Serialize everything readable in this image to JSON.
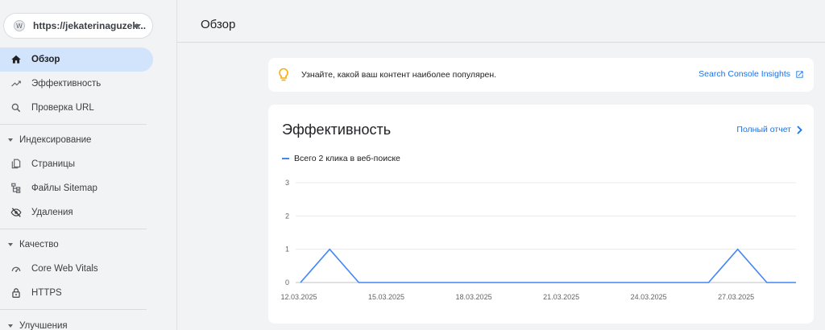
{
  "property": {
    "url": "https://jekaterinaguzek...",
    "icon": "wordpress-icon"
  },
  "sidebar": {
    "items": [
      {
        "label": "Обзор",
        "icon": "home-icon",
        "active": true
      },
      {
        "label": "Эффективность",
        "icon": "trending-up-icon"
      },
      {
        "label": "Проверка URL",
        "icon": "search-icon"
      }
    ],
    "sections": [
      {
        "label": "Индексирование",
        "items": [
          {
            "label": "Страницы",
            "icon": "pages-icon"
          },
          {
            "label": "Файлы Sitemap",
            "icon": "sitemap-icon"
          },
          {
            "label": "Удаления",
            "icon": "eye-off-icon"
          }
        ]
      },
      {
        "label": "Качество",
        "items": [
          {
            "label": "Core Web Vitals",
            "icon": "gauge-icon"
          },
          {
            "label": "HTTPS",
            "icon": "lock-icon"
          }
        ]
      },
      {
        "label": "Улучшения",
        "items": []
      }
    ]
  },
  "header": {
    "title": "Обзор"
  },
  "banner": {
    "text": "Узнайте, какой ваш контент наиболее популярен.",
    "link": "Search Console Insights",
    "icon": "lightbulb-icon",
    "link_icon": "open-in-new-icon"
  },
  "performance": {
    "title": "Эффективность",
    "full_report": "Полный отчет",
    "legend": "Всего 2 клика в веб-поиске"
  },
  "colors": {
    "accent": "#1a73e8",
    "series": "#4285f4",
    "active_nav": "#d2e3fc"
  },
  "chart_data": {
    "type": "line",
    "title": "",
    "xlabel": "",
    "ylabel": "",
    "ylim": [
      0,
      3
    ],
    "yticks": [
      0,
      1,
      2,
      3
    ],
    "x_ticks": [
      "12.03.2025",
      "15.03.2025",
      "18.03.2025",
      "21.03.2025",
      "24.03.2025",
      "27.03.2025"
    ],
    "x": [
      "12.03.2025",
      "13.03.2025",
      "14.03.2025",
      "15.03.2025",
      "16.03.2025",
      "17.03.2025",
      "18.03.2025",
      "19.03.2025",
      "20.03.2025",
      "21.03.2025",
      "22.03.2025",
      "23.03.2025",
      "24.03.2025",
      "25.03.2025",
      "26.03.2025",
      "27.03.2025",
      "28.03.2025",
      "29.03.2025"
    ],
    "series": [
      {
        "name": "Всего 2 клика в веб-поиске",
        "values": [
          0,
          1,
          0,
          0,
          0,
          0,
          0,
          0,
          0,
          0,
          0,
          0,
          0,
          0,
          0,
          1,
          0,
          0
        ]
      }
    ],
    "grid": true
  }
}
